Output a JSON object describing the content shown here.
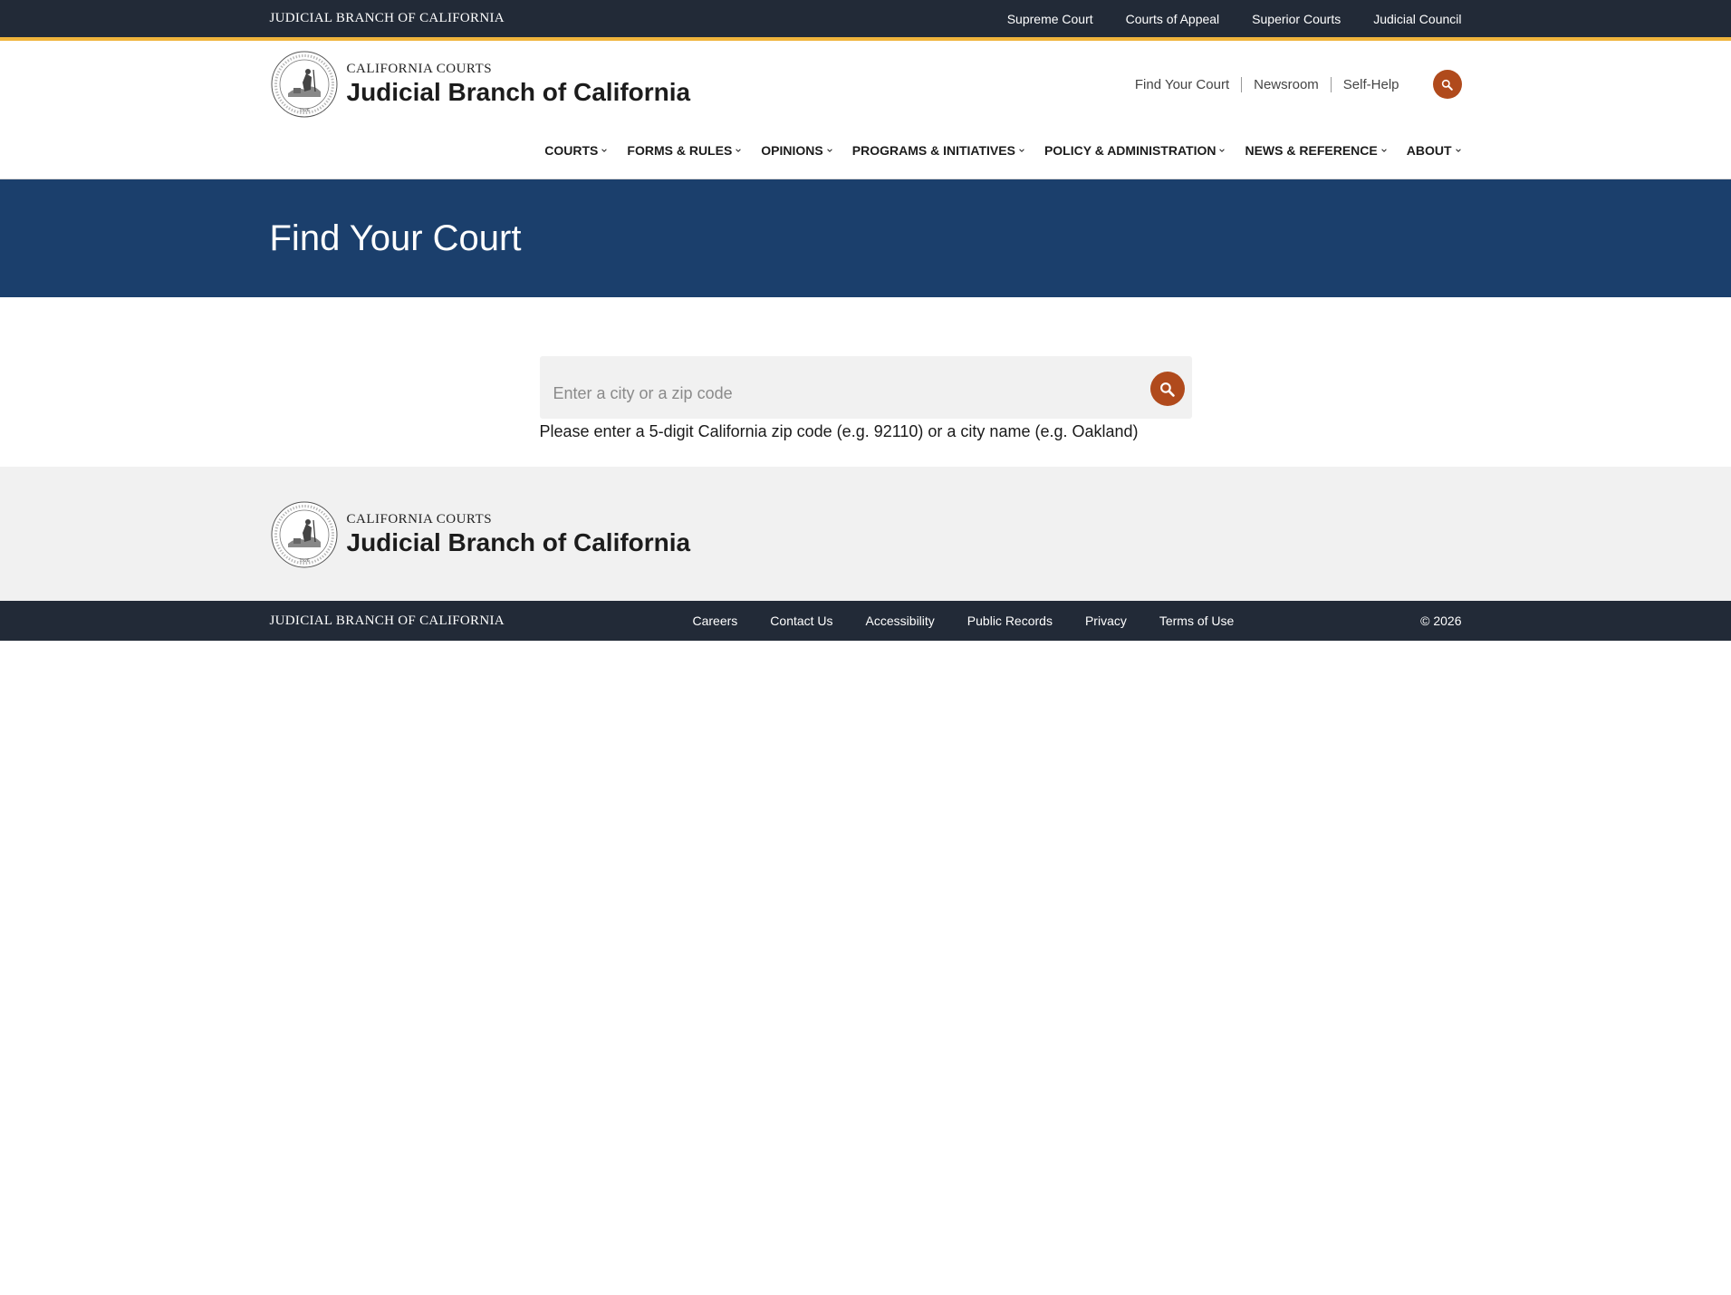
{
  "topbar": {
    "brand": "JUDICIAL BRANCH OF CALIFORNIA",
    "links": [
      "Supreme Court",
      "Courts of Appeal",
      "Superior Courts",
      "Judicial Council"
    ]
  },
  "header": {
    "logo_sub": "CALIFORNIA COURTS",
    "logo_title": "Judicial Branch of California",
    "util_links": [
      "Find Your Court",
      "Newsroom",
      "Self-Help"
    ],
    "nav": [
      "COURTS",
      "FORMS & RULES",
      "OPINIONS",
      "PROGRAMS & INITIATIVES",
      "POLICY & ADMINISTRATION",
      "NEWS & REFERENCE",
      "ABOUT"
    ]
  },
  "hero": {
    "title": "Find Your Court"
  },
  "search": {
    "placeholder": "Enter a city or a zip code",
    "value": "",
    "hint": "Please enter a 5-digit California zip code (e.g. 92110) or a city name (e.g. Oakland)"
  },
  "footer": {
    "logo_sub": "CALIFORNIA COURTS",
    "logo_title": "Judicial Branch of California",
    "brand": "JUDICIAL BRANCH OF CALIFORNIA",
    "links": [
      "Careers",
      "Contact Us",
      "Accessibility",
      "Public Records",
      "Privacy",
      "Terms of Use"
    ],
    "copyright": "© 2026"
  },
  "colors": {
    "topbar_bg": "#222a37",
    "accent_stripe": "#f0b43c",
    "hero_bg": "#1b3f6c",
    "search_button": "#b04a1c",
    "footer_bg": "#f1f1f1"
  }
}
